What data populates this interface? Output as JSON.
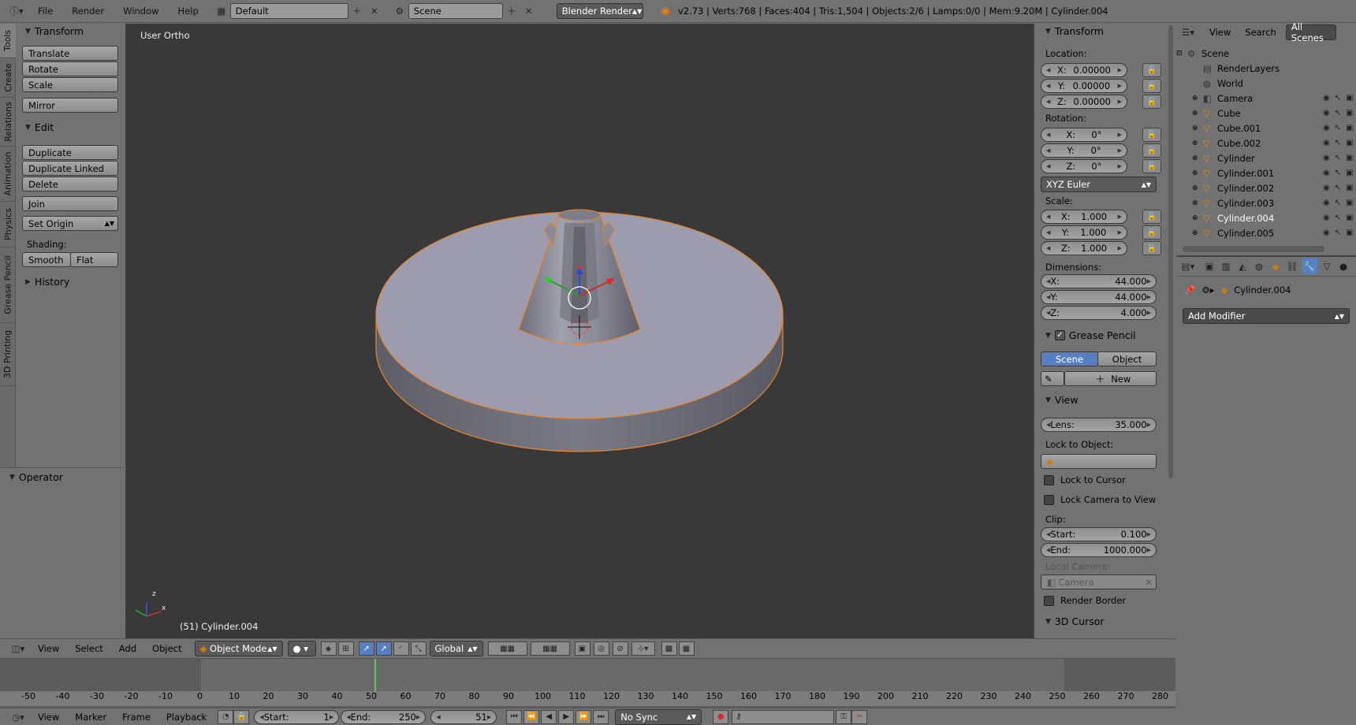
{
  "topbar": {
    "menus": [
      "File",
      "Render",
      "Window",
      "Help"
    ],
    "layout": "Default",
    "scene": "Scene",
    "engine": "Blender Render",
    "stats": "v2.73 | Verts:768 | Faces:404 | Tris:1,504 | Objects:2/6 | Lamps:0/0 | Mem:9.20M | Cylinder.004"
  },
  "tabs": [
    "Tools",
    "Create",
    "Relations",
    "Animation",
    "Physics",
    "Grease Pencil",
    "3D Printing"
  ],
  "tools": {
    "transform_header": "Transform",
    "translate": "Translate",
    "rotate": "Rotate",
    "scale": "Scale",
    "mirror": "Mirror",
    "edit_header": "Edit",
    "duplicate": "Duplicate",
    "duplicate_linked": "Duplicate Linked",
    "delete": "Delete",
    "join": "Join",
    "set_origin": "Set Origin",
    "shading_label": "Shading:",
    "smooth": "Smooth",
    "flat": "Flat",
    "history_header": "History",
    "operator_header": "Operator"
  },
  "viewport": {
    "view_name": "User Ortho",
    "object_label": "(51) Cylinder.004"
  },
  "npanel": {
    "transform_header": "Transform",
    "location_label": "Location:",
    "location": {
      "x": "0.00000",
      "y": "0.00000",
      "z": "0.00000"
    },
    "rotation_label": "Rotation:",
    "rotation": {
      "x": "0°",
      "y": "0°",
      "z": "0°"
    },
    "rotation_mode": "XYZ Euler",
    "scale_label": "Scale:",
    "scale": {
      "x": "1.000",
      "y": "1.000",
      "z": "1.000"
    },
    "dimensions_label": "Dimensions:",
    "dimensions": {
      "x": "44.000",
      "y": "44.000",
      "z": "4.000"
    },
    "axis_x": "X:",
    "axis_y": "Y:",
    "axis_z": "Z:",
    "grease_header": "Grease Pencil",
    "gp_scene": "Scene",
    "gp_object": "Object",
    "gp_new": "New",
    "view_header": "View",
    "lens_label": "Lens:",
    "lens": "35.000",
    "lock_object_label": "Lock to Object:",
    "lock_cursor": "Lock to Cursor",
    "lock_camera": "Lock Camera to View",
    "clip_label": "Clip:",
    "clip_start_label": "Start:",
    "clip_start": "0.100",
    "clip_end_label": "End:",
    "clip_end": "1000.000",
    "local_camera_label": "Local Camera:",
    "local_camera": "Camera",
    "render_border": "Render Border",
    "cursor_header": "3D Cursor"
  },
  "outliner": {
    "menus": [
      "View",
      "Search"
    ],
    "filter": "All Scenes",
    "items": [
      "Scene",
      "RenderLayers",
      "World",
      "Camera",
      "Cube",
      "Cube.001",
      "Cube.002",
      "Cylinder",
      "Cylinder.001",
      "Cylinder.002",
      "Cylinder.003",
      "Cylinder.004",
      "Cylinder.005"
    ]
  },
  "properties": {
    "object_name": "Cylinder.004",
    "add_modifier": "Add Modifier"
  },
  "view_header": {
    "menus": [
      "View",
      "Select",
      "Add",
      "Object"
    ],
    "mode": "Object Mode",
    "orientation": "Global"
  },
  "timeline": {
    "ticks": [
      "-50",
      "-40",
      "-30",
      "-20",
      "-10",
      "0",
      "10",
      "20",
      "30",
      "40",
      "50",
      "60",
      "70",
      "80",
      "90",
      "100",
      "110",
      "120",
      "130",
      "140",
      "150",
      "160",
      "170",
      "180",
      "190",
      "200",
      "210",
      "220",
      "230",
      "240",
      "250",
      "260",
      "270",
      "280"
    ],
    "menus": [
      "View",
      "Marker",
      "Frame",
      "Playback"
    ],
    "start_label": "Start:",
    "start": "1",
    "end_label": "End:",
    "end": "250",
    "current": "51",
    "sync": "No Sync"
  },
  "colors": {
    "selection_outline": "#e8862a",
    "active_blue": "#5680c2",
    "viewport_bg": "#393939"
  }
}
